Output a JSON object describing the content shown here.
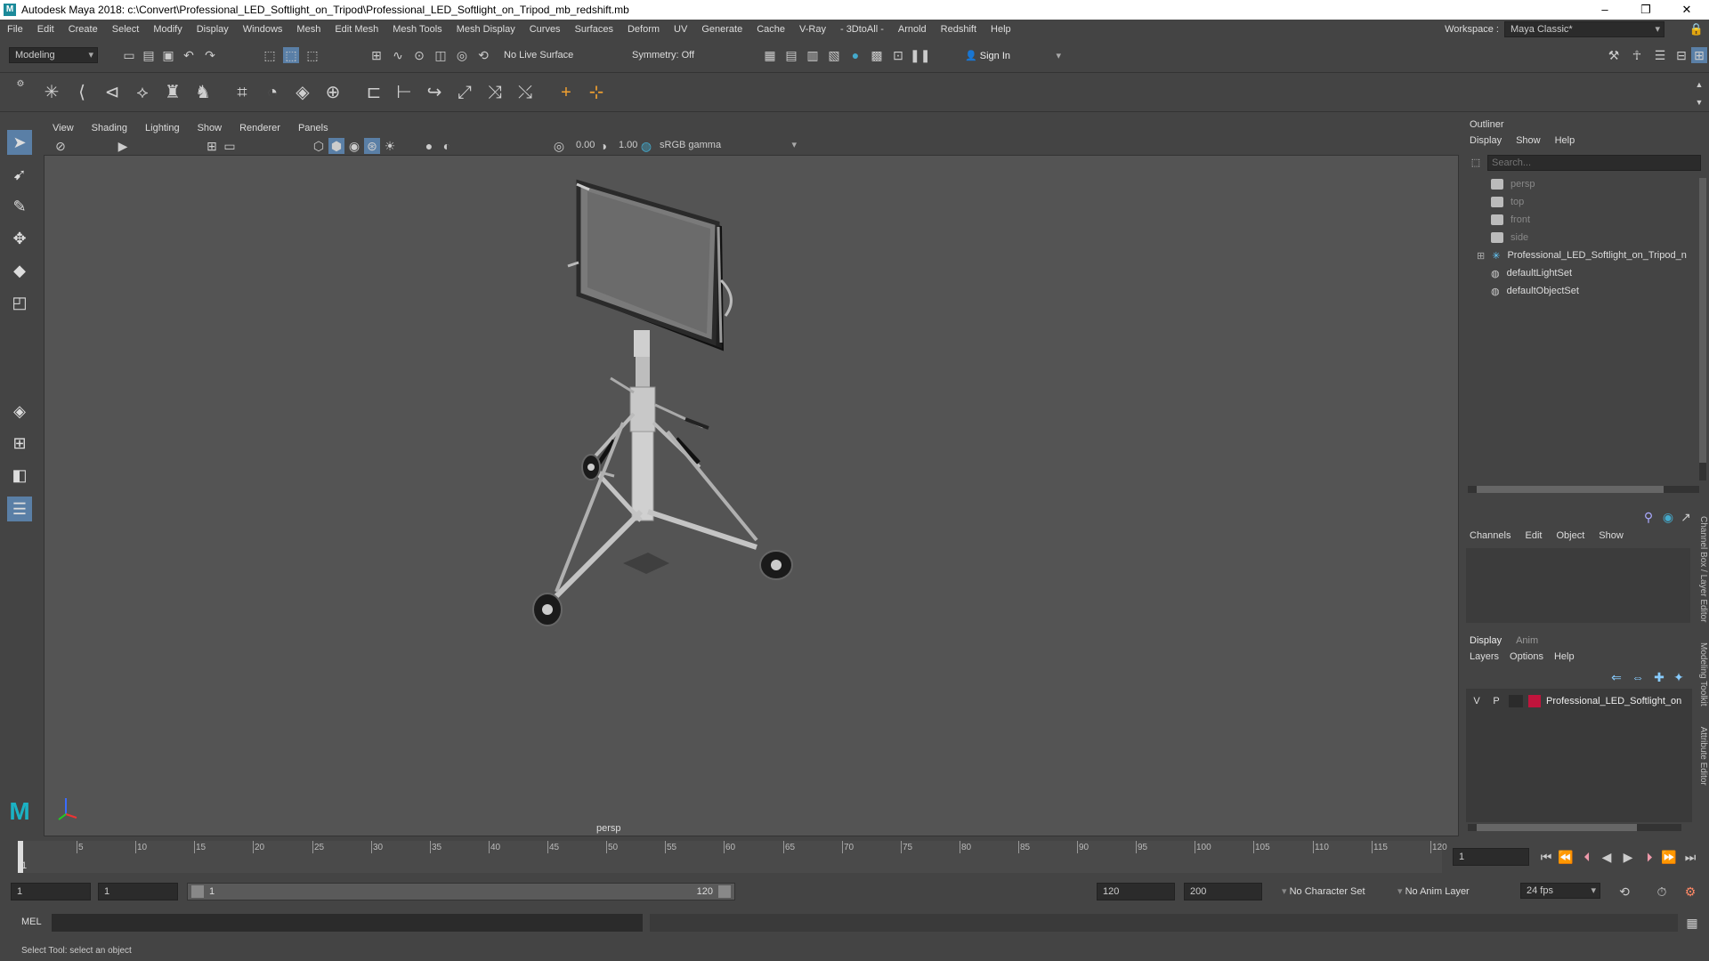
{
  "window": {
    "title": "Autodesk Maya 2018: c:\\Convert\\Professional_LED_Softlight_on_Tripod\\Professional_LED_Softlight_on_Tripod_mb_redshift.mb",
    "logo": "M"
  },
  "menubar": {
    "items": [
      "File",
      "Edit",
      "Create",
      "Select",
      "Modify",
      "Display",
      "Windows",
      "Mesh",
      "Edit Mesh",
      "Mesh Tools",
      "Mesh Display",
      "Curves",
      "Surfaces",
      "Deform",
      "UV",
      "Generate",
      "Cache",
      "V-Ray",
      "- 3DtoAll -",
      "Arnold",
      "Redshift",
      "Help"
    ],
    "workspace_label": "Workspace :",
    "workspace_value": "Maya Classic*"
  },
  "statusline": {
    "mode": "Modeling",
    "live_surface": "No Live Surface",
    "symmetry": "Symmetry: Off",
    "sign_in": "Sign In"
  },
  "viewport": {
    "menus": [
      "View",
      "Shading",
      "Lighting",
      "Show",
      "Renderer",
      "Panels"
    ],
    "exposure": "0.00",
    "gamma": "1.00",
    "colorspace": "sRGB gamma",
    "camera": "persp"
  },
  "outliner": {
    "title": "Outliner",
    "menus": [
      "Display",
      "Show",
      "Help"
    ],
    "search_placeholder": "Search...",
    "items": [
      {
        "label": "persp",
        "dim": true
      },
      {
        "label": "top",
        "dim": true
      },
      {
        "label": "front",
        "dim": true
      },
      {
        "label": "side",
        "dim": true
      },
      {
        "label": "Professional_LED_Softlight_on_Tripod_n",
        "dim": false
      },
      {
        "label": "defaultLightSet",
        "dim": false
      },
      {
        "label": "defaultObjectSet",
        "dim": false
      }
    ]
  },
  "channelbox": {
    "menus": [
      "Channels",
      "Edit",
      "Object",
      "Show"
    ],
    "side_tabs": [
      "Channel Box / Layer Editor",
      "Modeling Toolkit",
      "Attribute Editor"
    ]
  },
  "layers": {
    "tabs": [
      "Display",
      "Anim"
    ],
    "menus": [
      "Layers",
      "Options",
      "Help"
    ],
    "row": {
      "v": "V",
      "p": "P",
      "name": "Professional_LED_Softlight_on",
      "color": "#c0143c"
    }
  },
  "timeline": {
    "ticks": [
      "5",
      "10",
      "15",
      "20",
      "25",
      "30",
      "35",
      "40",
      "45",
      "50",
      "55",
      "60",
      "65",
      "70",
      "75",
      "80",
      "85",
      "90",
      "95",
      "100",
      "105",
      "110",
      "115",
      "120"
    ],
    "start": "1",
    "current": "1"
  },
  "range": {
    "start": "1",
    "start2": "1",
    "slider_start": "1",
    "slider_end": "120",
    "end": "120",
    "end2": "200",
    "character_set": "No Character Set",
    "anim_layer": "No Anim Layer",
    "fps": "24 fps"
  },
  "cmdline": {
    "label": "MEL"
  },
  "helpline": {
    "text": "Select Tool: select an object"
  }
}
